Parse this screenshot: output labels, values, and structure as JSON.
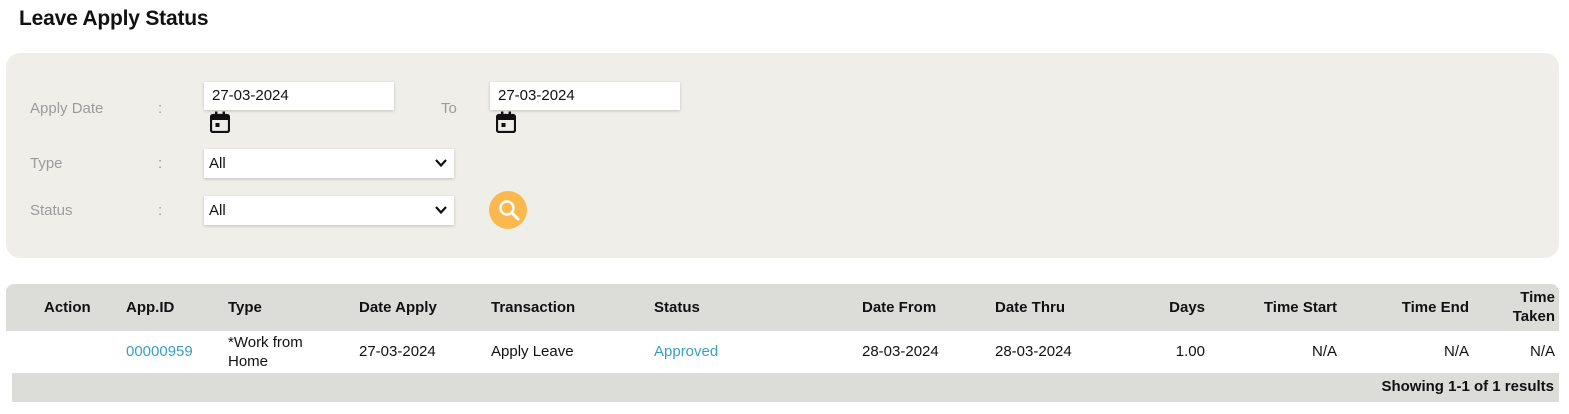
{
  "page": {
    "title": "Leave Apply Status"
  },
  "filters": {
    "apply_date_label": "Apply Date",
    "colon": ":",
    "to_label": "To",
    "date_from": "27-03-2024",
    "date_to": "27-03-2024",
    "type_label": "Type",
    "type_value": "All",
    "status_label": "Status",
    "status_value": "All",
    "calendar_icon": "calendar-icon",
    "search_icon": "search-icon",
    "search_button_color": "#fbb84f"
  },
  "table": {
    "headers": {
      "action": "Action",
      "app_id": "App.ID",
      "type": "Type",
      "date_apply": "Date Apply",
      "transaction": "Transaction",
      "status": "Status",
      "date_from": "Date From",
      "date_thru": "Date Thru",
      "days": "Days",
      "time_start": "Time Start",
      "time_end": "Time End",
      "time_taken_1": "Time",
      "time_taken_2": "Taken"
    },
    "rows": [
      {
        "action": "",
        "app_id": "00000959",
        "type_line1": "*Work from",
        "type_line2": "Home",
        "date_apply": "27-03-2024",
        "transaction": "Apply Leave",
        "status": "Approved",
        "date_from": "28-03-2024",
        "date_thru": "28-03-2024",
        "days": "1.00",
        "time_start": "N/A",
        "time_end": "N/A",
        "time_taken": "N/A"
      }
    ],
    "footer": "Showing 1-1 of 1 results",
    "link_color": "#3a9fc2"
  }
}
